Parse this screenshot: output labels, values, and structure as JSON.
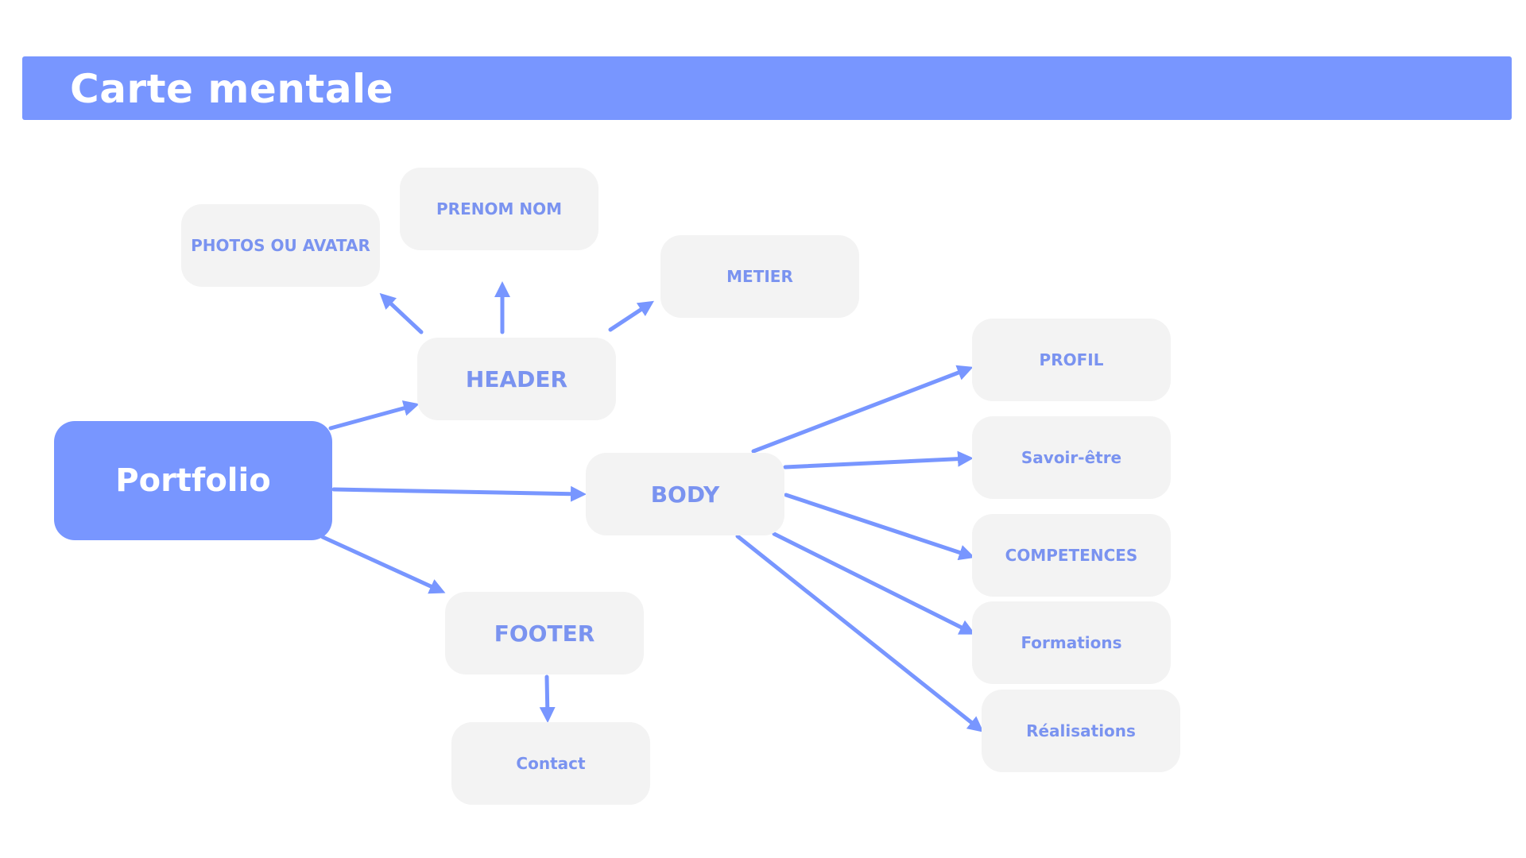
{
  "title": "Carte mentale",
  "nodes": {
    "portfolio": "Portfolio",
    "header": "HEADER",
    "body": "BODY",
    "footer": "FOOTER",
    "photos": "PHOTOS OU AVATAR",
    "prenom_nom": "PRENOM NOM",
    "metier": "METIER",
    "profil": "PROFIL",
    "savoir_etre": "Savoir-être",
    "competences": "COMPETENCES",
    "formations": "Formations",
    "realisations": "Réalisations",
    "contact": "Contact"
  },
  "colors": {
    "accent": "#7896ff",
    "node_fill": "#f3f3f3",
    "node_text": "#7a93f0",
    "arrow": "#7896ff"
  }
}
